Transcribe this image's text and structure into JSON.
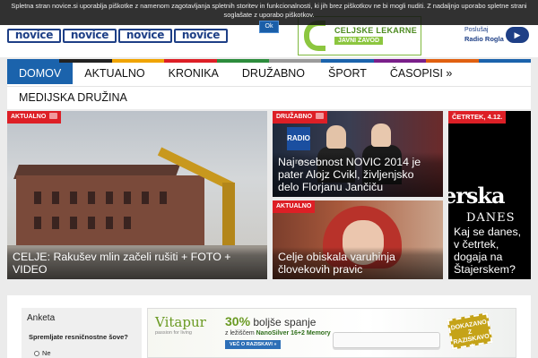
{
  "cookie": {
    "text": "Spletna stran novice.si uporablja piškotke z namenom zagotavljanja spletnih storitev in funkcionalnosti, ki jih brez piškotkov ne bi mogli nuditi. Z nadaljnjo uporabo spletne strani soglašate z uporabo piškotkov.",
    "ok_label": "Ok"
  },
  "header": {
    "logo_text": "novice",
    "ad": {
      "line1": "CELJSKE LEKARNE",
      "line2": "JAVNI ZAVOD"
    },
    "radio": {
      "line1": "Poslušaj",
      "line2": "Radio Rogla"
    }
  },
  "nav": {
    "colors": [
      "#1b63ac",
      "#222222",
      "#f0a400",
      "#dd1f26",
      "#2c8c3c",
      "#9a9a9a",
      "#1b63ac",
      "#7a1f8a",
      "#e06010",
      "#1b63ac"
    ],
    "items": [
      "DOMOV",
      "AKTUALNO",
      "KRONIKA",
      "DRUŽABNO",
      "ŠPORT",
      "ČASOPISI »"
    ],
    "row2_items": [
      "MEDIJSKA DRUŽINA"
    ]
  },
  "tiles": {
    "main": {
      "tag": "AKTUALNO",
      "headline": "CELJE: Rakušev mlin začeli rušiti + FOTO + VIDEO"
    },
    "novic": {
      "tag": "DRUŽABNO",
      "headline": "Naj osebnost NOVIC 2014 je pater Alojz Cvikl, življenjsko delo Florjanu Jančiču",
      "photo_text": "RADIO ro"
    },
    "celje2": {
      "tag": "AKTUALNO",
      "headline": "Celje obiskala varuhinja človekovih pravic"
    },
    "stajer": {
      "date": "ČETRTEK, 4.12.",
      "word": "erska",
      "danes": "DANES",
      "headline": "Kaj se danes, v četrtek, dogaja na Štajerskem?"
    }
  },
  "poll": {
    "title": "Anketa",
    "question": "Spremljate resničnostne šove?",
    "option1": "Ne"
  },
  "banner": {
    "brand": "Vitapur",
    "brand_sub": "passion for living",
    "headline_pct": "30%",
    "headline_rest": " boljše spanje",
    "line_prefix": "z ležiščem ",
    "line_product": "NanoSilver 16+2 Memory",
    "cta": "VEČ O RAZISKAVI »",
    "badge": "DOKAZANO Z RAZISKAVO !"
  }
}
